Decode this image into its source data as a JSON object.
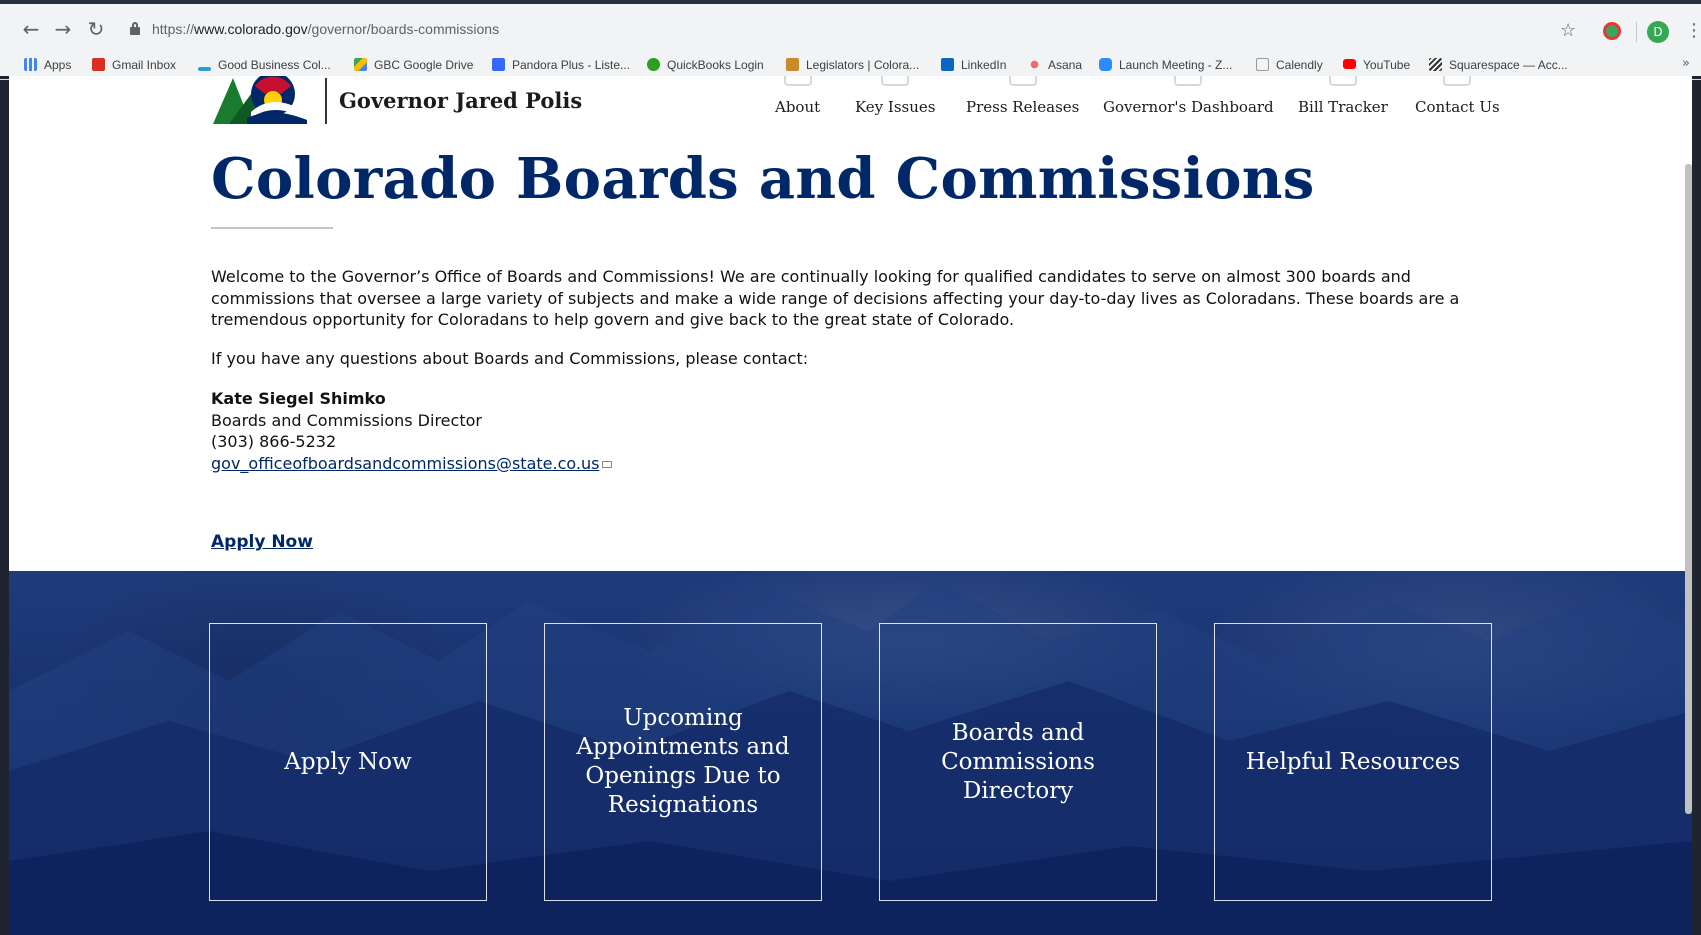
{
  "browser": {
    "url_prefix": "https://",
    "url_domain": "www.colorado.gov",
    "url_path": "/governor/boards-commissions",
    "profile_initial": "D",
    "bookmarks": [
      {
        "label": "Apps",
        "icon": "apps-grid-icon",
        "color": "#4285f4"
      },
      {
        "label": "Gmail Inbox",
        "icon": "gmail-icon",
        "color": "#d93025"
      },
      {
        "label": "Good Business Col...",
        "icon": "good-business-icon",
        "color": "#2a9fd6"
      },
      {
        "label": "GBC Google Drive",
        "icon": "google-drive-icon",
        "color": "#fbbc04"
      },
      {
        "label": "Pandora Plus - Liste...",
        "icon": "pandora-icon",
        "color": "#3668ff"
      },
      {
        "label": "QuickBooks Login",
        "icon": "quickbooks-icon",
        "color": "#2ca01c"
      },
      {
        "label": "Legislators | Colora...",
        "icon": "capitol-icon",
        "color": "#c98a2b"
      },
      {
        "label": "LinkedIn",
        "icon": "linkedin-icon",
        "color": "#0a66c2"
      },
      {
        "label": "Asana",
        "icon": "asana-icon",
        "color": "#f06a6a"
      },
      {
        "label": "Launch Meeting - Z...",
        "icon": "zoom-icon",
        "color": "#2d8cff"
      },
      {
        "label": "Calendly",
        "icon": "calendly-icon",
        "color": "#999999"
      },
      {
        "label": "YouTube",
        "icon": "youtube-icon",
        "color": "#ff0000"
      },
      {
        "label": "Squarespace — Acc...",
        "icon": "squarespace-icon",
        "color": "#333333"
      }
    ]
  },
  "header": {
    "brand": "Governor Jared Polis",
    "nav": [
      "About",
      "Key Issues",
      "Press Releases",
      "Governor's Dashboard",
      "Bill Tracker",
      "Contact Us"
    ]
  },
  "main": {
    "title": "Colorado Boards and Commissions",
    "intro": "Welcome to the Governor’s Office of Boards and Commissions! We are continually looking for qualified candidates to serve on almost 300 boards and commissions that oversee a large variety of subjects and make a wide range of decisions affecting your day-to-day lives as Coloradans. These boards are a tremendous opportunity for Coloradans to help govern and give back to the great state of Colorado.",
    "questions": "If you have any questions about Boards and Commissions, please contact:",
    "contact": {
      "name": "Kate Siegel Shimko",
      "role": "Boards and Commissions Director",
      "phone": "(303) 866-5232",
      "email": "gov_officeofboardsandcommissions@state.co.us"
    },
    "apply_link": "Apply Now"
  },
  "tiles": [
    "Apply Now",
    "Upcoming Appointments and Openings Due to Resignations",
    "Boards and Commissions Directory",
    "Helpful Resources"
  ],
  "colors": {
    "brand_navy": "#002868",
    "hero_blue": "#17306d"
  }
}
